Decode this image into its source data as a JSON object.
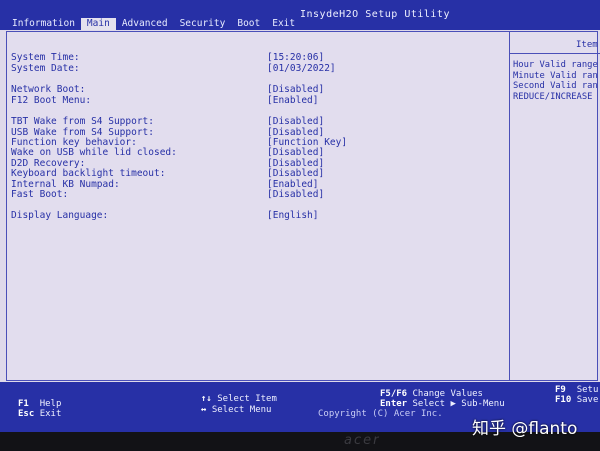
{
  "title": "InsydeH2O Setup Utility",
  "menu": [
    {
      "label": "Information"
    },
    {
      "label": "Main"
    },
    {
      "label": "Advanced"
    },
    {
      "label": "Security"
    },
    {
      "label": "Boot"
    },
    {
      "label": "Exit"
    }
  ],
  "active_menu": "Main",
  "help": {
    "title": "Item",
    "lines": "Hour Valid range\nMinute Valid ran\nSecond Valid ran\nREDUCE/INCREASE"
  },
  "settings": [
    {
      "label": "System Time:",
      "value": "[15:20:06]"
    },
    {
      "label": "System Date:",
      "value": "[01/03/2022]"
    },
    {
      "label": "Network Boot:",
      "value": "[Disabled]"
    },
    {
      "label": "F12 Boot Menu:",
      "value": "[Enabled]"
    },
    {
      "label": "TBT Wake from S4 Support:",
      "value": "[Disabled]"
    },
    {
      "label": "USB Wake from S4 Support:",
      "value": "[Disabled]"
    },
    {
      "label": "Function key behavior:",
      "value": "[Function Key]"
    },
    {
      "label": "Wake on USB while lid closed:",
      "value": "[Disabled]"
    },
    {
      "label": "D2D Recovery:",
      "value": "[Disabled]"
    },
    {
      "label": "Keyboard backlight timeout:",
      "value": "[Disabled]"
    },
    {
      "label": "Internal KB Numpad:",
      "value": "[Enabled]"
    },
    {
      "label": "Fast Boot:",
      "value": "[Disabled]"
    },
    {
      "label": "Display Language:",
      "value": "[English]"
    }
  ],
  "footer": {
    "f1_key": "F1",
    "f1_label": "Help",
    "esc_key": "Esc",
    "esc_label": "Exit",
    "updown_key": "↑↓",
    "updown_label": "Select Item",
    "leftright_key": "↔",
    "leftright_label": "Select Menu",
    "f5f6_key": "F5/F6",
    "f5f6_label": "Change Values",
    "enter_key": "Enter",
    "enter_label": "Select ▶ Sub-Menu",
    "f9_key": "F9",
    "f9_label": "Setu",
    "f10_key": "F10",
    "f10_label": "Save",
    "copyright": "Copyright (C) Acer Inc."
  },
  "bezel_logo": "acer",
  "watermark": "知乎 @flanto"
}
